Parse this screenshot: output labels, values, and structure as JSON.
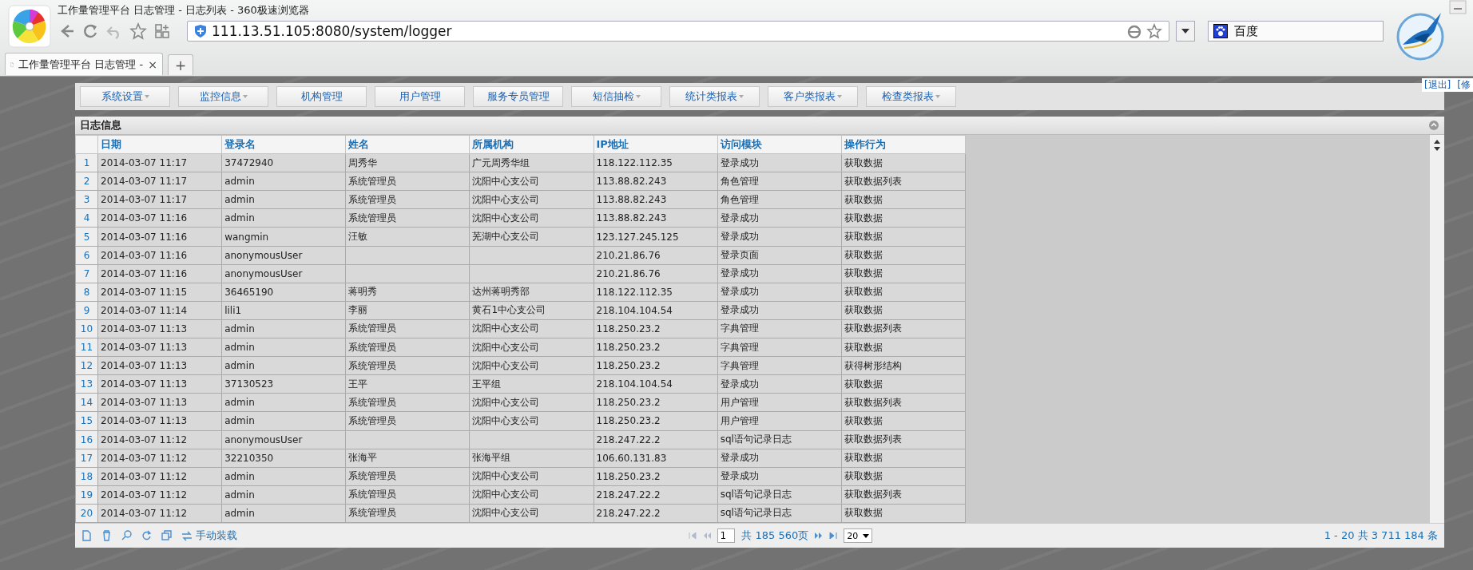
{
  "browser": {
    "window_title": "工作量管理平台 日志管理 - 日志列表 - 360极速浏览器",
    "tab_title": "工作量管理平台 日志管理 -",
    "tab_close": "×",
    "new_tab": "+",
    "address": "111.13.51.105:8080/system/logger",
    "search_engine": "百度"
  },
  "top_links": [
    "[退出]",
    "[修"
  ],
  "menu": [
    {
      "label": "系统设置",
      "dropdown": true
    },
    {
      "label": "监控信息",
      "dropdown": true
    },
    {
      "label": "机构管理",
      "dropdown": false
    },
    {
      "label": "用户管理",
      "dropdown": false
    },
    {
      "label": "服务专员管理",
      "dropdown": false
    },
    {
      "label": "短信抽检",
      "dropdown": true
    },
    {
      "label": "统计类报表",
      "dropdown": true
    },
    {
      "label": "客户类报表",
      "dropdown": true
    },
    {
      "label": "检查类报表",
      "dropdown": true
    }
  ],
  "grid": {
    "title": "日志信息",
    "columns": [
      "日期",
      "登录名",
      "姓名",
      "所属机构",
      "IP地址",
      "访问模块",
      "操作行为"
    ],
    "rows": [
      {
        "index": "1",
        "cells": [
          "2014-03-07 11:17",
          "37472940",
          "周秀华",
          "广元周秀华组",
          "118.122.112.35",
          "登录成功",
          "获取数据"
        ]
      },
      {
        "index": "2",
        "cells": [
          "2014-03-07 11:17",
          "admin",
          "系统管理员",
          "沈阳中心支公司",
          "113.88.82.243",
          "角色管理",
          "获取数据列表"
        ]
      },
      {
        "index": "3",
        "cells": [
          "2014-03-07 11:17",
          "admin",
          "系统管理员",
          "沈阳中心支公司",
          "113.88.82.243",
          "角色管理",
          "获取数据"
        ]
      },
      {
        "index": "4",
        "cells": [
          "2014-03-07 11:16",
          "admin",
          "系统管理员",
          "沈阳中心支公司",
          "113.88.82.243",
          "登录成功",
          "获取数据"
        ]
      },
      {
        "index": "5",
        "cells": [
          "2014-03-07 11:16",
          "wangmin",
          "汪敏",
          "芜湖中心支公司",
          "123.127.245.125",
          "登录成功",
          "获取数据"
        ]
      },
      {
        "index": "6",
        "cells": [
          "2014-03-07 11:16",
          "anonymousUser",
          "",
          "",
          "210.21.86.76",
          "登录页面",
          "获取数据"
        ]
      },
      {
        "index": "7",
        "cells": [
          "2014-03-07 11:16",
          "anonymousUser",
          "",
          "",
          "210.21.86.76",
          "登录成功",
          "获取数据"
        ]
      },
      {
        "index": "8",
        "cells": [
          "2014-03-07 11:15",
          "36465190",
          "蒋明秀",
          "达州蒋明秀部",
          "118.122.112.35",
          "登录成功",
          "获取数据"
        ]
      },
      {
        "index": "9",
        "cells": [
          "2014-03-07 11:14",
          "lili1",
          "李丽",
          "黄石1中心支公司",
          "218.104.104.54",
          "登录成功",
          "获取数据"
        ]
      },
      {
        "index": "10",
        "cells": [
          "2014-03-07 11:13",
          "admin",
          "系统管理员",
          "沈阳中心支公司",
          "118.250.23.2",
          "字典管理",
          "获取数据列表"
        ]
      },
      {
        "index": "11",
        "cells": [
          "2014-03-07 11:13",
          "admin",
          "系统管理员",
          "沈阳中心支公司",
          "118.250.23.2",
          "字典管理",
          "获取数据"
        ]
      },
      {
        "index": "12",
        "cells": [
          "2014-03-07 11:13",
          "admin",
          "系统管理员",
          "沈阳中心支公司",
          "118.250.23.2",
          "字典管理",
          "获得树形结构"
        ]
      },
      {
        "index": "13",
        "cells": [
          "2014-03-07 11:13",
          "37130523",
          "王平",
          "王平组",
          "218.104.104.54",
          "登录成功",
          "获取数据"
        ]
      },
      {
        "index": "14",
        "cells": [
          "2014-03-07 11:13",
          "admin",
          "系统管理员",
          "沈阳中心支公司",
          "118.250.23.2",
          "用户管理",
          "获取数据列表"
        ]
      },
      {
        "index": "15",
        "cells": [
          "2014-03-07 11:13",
          "admin",
          "系统管理员",
          "沈阳中心支公司",
          "118.250.23.2",
          "用户管理",
          "获取数据"
        ]
      },
      {
        "index": "16",
        "cells": [
          "2014-03-07 11:12",
          "anonymousUser",
          "",
          "",
          "218.247.22.2",
          "sql语句记录日志",
          "获取数据列表"
        ]
      },
      {
        "index": "17",
        "cells": [
          "2014-03-07 11:12",
          "32210350",
          "张海平",
          "张海平组",
          "106.60.131.83",
          "登录成功",
          "获取数据"
        ]
      },
      {
        "index": "18",
        "cells": [
          "2014-03-07 11:12",
          "admin",
          "系统管理员",
          "沈阳中心支公司",
          "118.250.23.2",
          "登录成功",
          "获取数据"
        ]
      },
      {
        "index": "19",
        "cells": [
          "2014-03-07 11:12",
          "admin",
          "系统管理员",
          "沈阳中心支公司",
          "218.247.22.2",
          "sql语句记录日志",
          "获取数据列表"
        ]
      },
      {
        "index": "20",
        "cells": [
          "2014-03-07 11:12",
          "admin",
          "系统管理员",
          "沈阳中心支公司",
          "218.247.22.2",
          "sql语句记录日志",
          "获取数据"
        ]
      }
    ],
    "footer": {
      "reload": "手动装载",
      "page": "1",
      "page_total": "共 185 560页",
      "page_size": "20",
      "summary": "1 - 20 共 3 711 184 条"
    }
  }
}
